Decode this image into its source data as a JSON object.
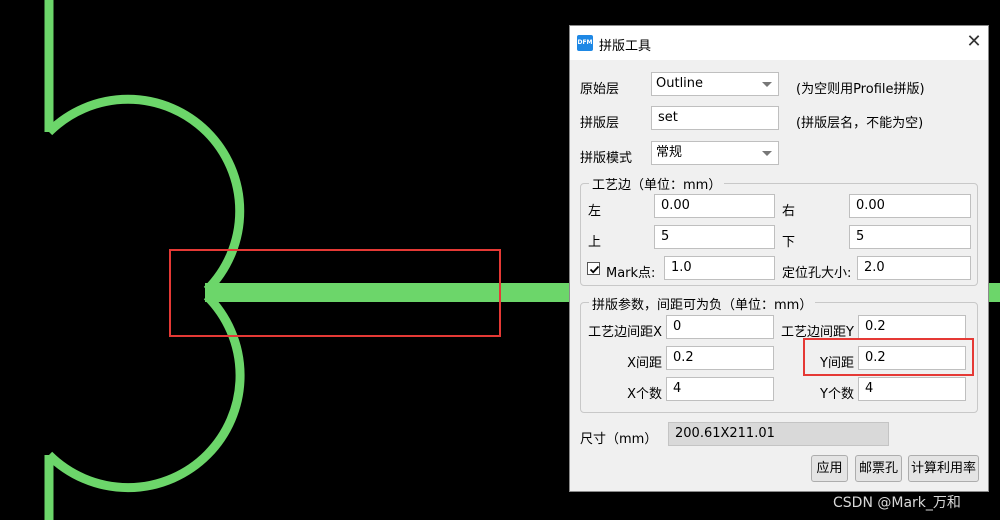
{
  "colors": {
    "trace": "#6cd66a",
    "highlight": "#e53935",
    "background": "#000000"
  },
  "dialog": {
    "icon": "DFM",
    "title": "拼版工具",
    "close": "✕",
    "source_layer": {
      "label": "原始层",
      "value": "Outline",
      "hint": "(为空则用Profile拼版)"
    },
    "panel_layer": {
      "label": "拼版层",
      "value": "set",
      "hint": "(拼版层名，不能为空)"
    },
    "panel_mode": {
      "label": "拼版模式",
      "value": "常规"
    },
    "edge_group": {
      "title": "工艺边（单位：mm）",
      "left_label": "左",
      "left_value": "0.00",
      "right_label": "右",
      "right_value": "0.00",
      "top_label": "上",
      "top_value": "5",
      "bottom_label": "下",
      "bottom_value": "5",
      "mark_checked": true,
      "mark_label": "Mark点:",
      "mark_value": "1.0",
      "hole_label": "定位孔大小:",
      "hole_value": "2.0"
    },
    "params_group": {
      "title": "拼版参数，间距可为负（单位：mm）",
      "edge_gap_x_label": "工艺边间距X",
      "edge_gap_x_value": "0",
      "edge_gap_y_label": "工艺边间距Y",
      "edge_gap_y_value": "0.2",
      "x_gap_label": "X间距",
      "x_gap_value": "0.2",
      "y_gap_label": "Y间距",
      "y_gap_value": "0.2",
      "x_count_label": "X个数",
      "x_count_value": "4",
      "y_count_label": "Y个数",
      "y_count_value": "4"
    },
    "size": {
      "label": "尺寸（mm）",
      "value": "200.61X211.01"
    },
    "buttons": {
      "apply": "应用",
      "stamp_hole": "邮票孔",
      "calc_util": "计算利用率"
    }
  },
  "watermark": "CSDN @Mark_万和"
}
